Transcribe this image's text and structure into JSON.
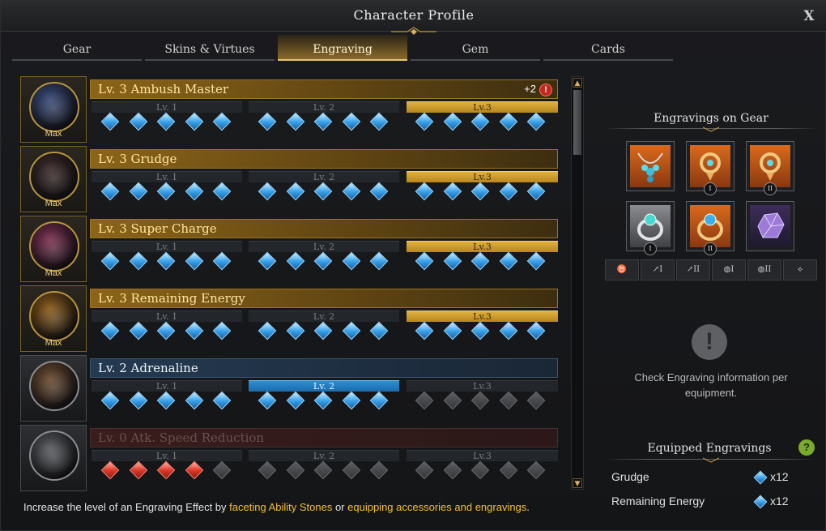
{
  "window": {
    "title": "Character Profile",
    "close_label": "X"
  },
  "tabs": [
    {
      "label": "Gear"
    },
    {
      "label": "Skins & Virtues"
    },
    {
      "label": "Engraving"
    },
    {
      "label": "Gem"
    },
    {
      "label": "Cards"
    }
  ],
  "active_tab": "Engraving",
  "engravings": [
    {
      "name": "Lv. 3 Ambush Master",
      "badge": "Max",
      "bonus": "+2",
      "bonus_icon": "!",
      "state": "gold",
      "levels": [
        "Lv. 1",
        "Lv. 2",
        "Lv.3"
      ],
      "active_level": 3,
      "nodes": [
        "blue",
        "blue",
        "blue",
        "blue",
        "blue",
        "blue",
        "blue",
        "blue",
        "blue",
        "blue",
        "blue",
        "blue",
        "blue",
        "blue",
        "blue"
      ]
    },
    {
      "name": "Lv. 3 Grudge",
      "badge": "Max",
      "state": "gold",
      "levels": [
        "Lv. 1",
        "Lv. 2",
        "Lv.3"
      ],
      "active_level": 3,
      "nodes": [
        "blue",
        "blue",
        "blue",
        "blue",
        "blue",
        "blue",
        "blue",
        "blue",
        "blue",
        "blue",
        "blue",
        "blue",
        "blue",
        "blue",
        "blue"
      ]
    },
    {
      "name": "Lv. 3 Super Charge",
      "badge": "Max",
      "state": "gold",
      "levels": [
        "Lv. 1",
        "Lv. 2",
        "Lv.3"
      ],
      "active_level": 3,
      "nodes": [
        "blue",
        "blue",
        "blue",
        "blue",
        "blue",
        "blue",
        "blue",
        "blue",
        "blue",
        "blue",
        "blue",
        "blue",
        "blue",
        "blue",
        "blue"
      ]
    },
    {
      "name": "Lv. 3 Remaining Energy",
      "badge": "Max",
      "state": "gold",
      "levels": [
        "Lv. 1",
        "Lv. 2",
        "Lv.3"
      ],
      "active_level": 3,
      "nodes": [
        "blue",
        "blue",
        "blue",
        "blue",
        "blue",
        "blue",
        "blue",
        "blue",
        "blue",
        "blue",
        "blue",
        "blue",
        "blue",
        "blue",
        "blue"
      ]
    },
    {
      "name": "Lv. 2 Adrenaline",
      "badge": "",
      "state": "blue",
      "levels": [
        "Lv. 1",
        "Lv. 2",
        "Lv.3"
      ],
      "active_level": 2,
      "nodes": [
        "blue",
        "blue",
        "blue",
        "blue",
        "blue",
        "blue",
        "blue",
        "blue",
        "blue",
        "blue",
        "empty",
        "empty",
        "empty",
        "empty",
        "empty"
      ]
    },
    {
      "name": "Lv. 0 Atk. Speed Reduction",
      "badge": "",
      "state": "red",
      "levels": [
        "Lv. 1",
        "Lv. 2",
        "Lv.3"
      ],
      "active_level": 0,
      "nodes": [
        "red",
        "red",
        "red",
        "red",
        "empty",
        "empty",
        "empty",
        "empty",
        "empty",
        "empty",
        "empty",
        "empty",
        "empty",
        "empty",
        "empty"
      ]
    }
  ],
  "footer": {
    "prefix": "Increase the level of an Engraving Effect by ",
    "link1": "faceting Ability Stones",
    "middle": " or ",
    "link2": "equipping accessories and engravings",
    "suffix": "."
  },
  "gear_panel": {
    "title": "Engravings on Gear",
    "slots": [
      {
        "icon": "necklace-icon",
        "roman": ""
      },
      {
        "icon": "earring-icon",
        "roman": "I"
      },
      {
        "icon": "earring-icon",
        "roman": "II"
      },
      {
        "icon": "ring-icon",
        "roman": "I"
      },
      {
        "icon": "ring-icon",
        "roman": "II"
      },
      {
        "icon": "ability-stone-icon",
        "roman": ""
      }
    ],
    "categories": [
      {
        "icon": "necklace-filter-icon",
        "roman": ""
      },
      {
        "icon": "earring-filter-icon",
        "roman": "I"
      },
      {
        "icon": "earring-filter-icon",
        "roman": "II"
      },
      {
        "icon": "ring-filter-icon",
        "roman": "I"
      },
      {
        "icon": "ring-filter-icon",
        "roman": "II"
      },
      {
        "icon": "stone-filter-icon",
        "roman": ""
      }
    ],
    "info_icon": "!",
    "info_text": "Check Engraving information per equipment."
  },
  "equipped": {
    "title": "Equipped Engravings",
    "help_label": "?",
    "items": [
      {
        "name": "Grudge",
        "count": "x12"
      },
      {
        "name": "Remaining Energy",
        "count": "x12"
      }
    ]
  },
  "colors": {
    "gold": "#e0b040",
    "blue_gem": "#3ca4ec",
    "red_gem": "#e03a2a",
    "accent_yellow": "#f0c030"
  }
}
